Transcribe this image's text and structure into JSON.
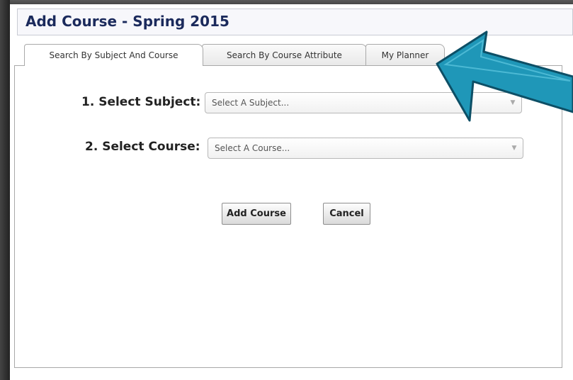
{
  "dialog": {
    "title": "Add Course - Spring 2015"
  },
  "tabs": [
    {
      "label": "Search By Subject And Course",
      "active": true
    },
    {
      "label": "Search By Course Attribute",
      "active": false
    },
    {
      "label": "My Planner",
      "active": false
    }
  ],
  "form": {
    "subject_label": "1. Select Subject:",
    "subject_placeholder": "Select A Subject...",
    "course_label": "2. Select Course:",
    "course_placeholder": "Select A Course..."
  },
  "buttons": {
    "add_label": "Add Course",
    "cancel_label": "Cancel"
  },
  "annotation": {
    "arrow_color": "#1f97b8",
    "arrow_target": "My Planner tab"
  }
}
